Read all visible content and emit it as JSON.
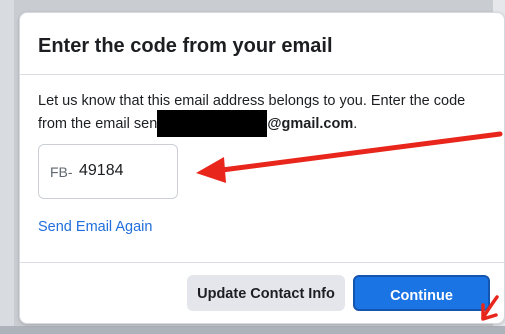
{
  "dialog": {
    "title": "Enter the code from your email",
    "body_line1": "Let us know that this email address belongs to you. Enter the code",
    "body_line2_prefix": "from the email sent t",
    "email_domain": "@gmail.com",
    "body_line2_suffix": "."
  },
  "code_input": {
    "prefix": "FB-",
    "value": "49184"
  },
  "send_again_label": "Send Email Again",
  "buttons": {
    "update_contact": "Update Contact Info",
    "continue": "Continue"
  },
  "colors": {
    "primary_button": "#1b74e4",
    "link": "#216fdb",
    "annotation_arrow": "#e8261c"
  }
}
